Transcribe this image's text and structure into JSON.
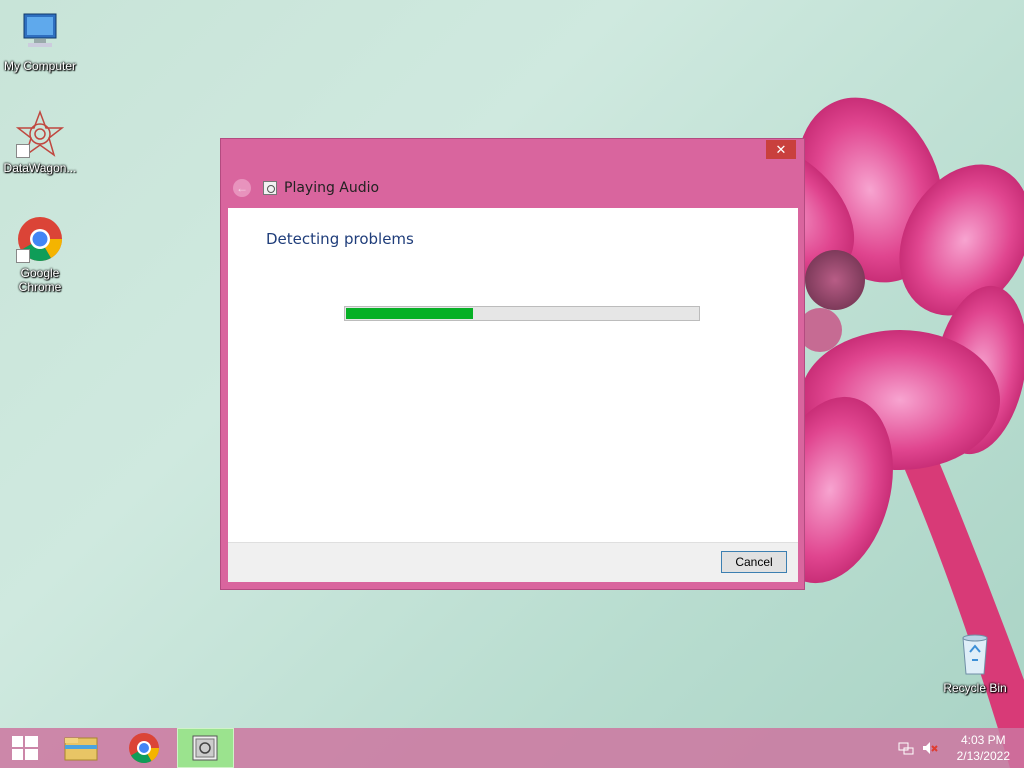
{
  "desktop": {
    "icons": [
      {
        "label": "My Computer"
      },
      {
        "label": "DataWagon..."
      },
      {
        "label": "Google Chrome"
      },
      {
        "label": "Recycle Bin"
      }
    ]
  },
  "dialog": {
    "close_label": "✕",
    "back_glyph": "←",
    "title": "Playing Audio",
    "heading": "Detecting problems",
    "progress_fraction": 0.36,
    "cancel_label": "Cancel"
  },
  "taskbar": {
    "time": "4:03 PM",
    "date": "2/13/2022"
  },
  "colors": {
    "dialog_frame": "#d9659e",
    "progress_fill": "#06b025",
    "heading_text": "#1f3d7a",
    "taskbar": "#cc76a0"
  }
}
